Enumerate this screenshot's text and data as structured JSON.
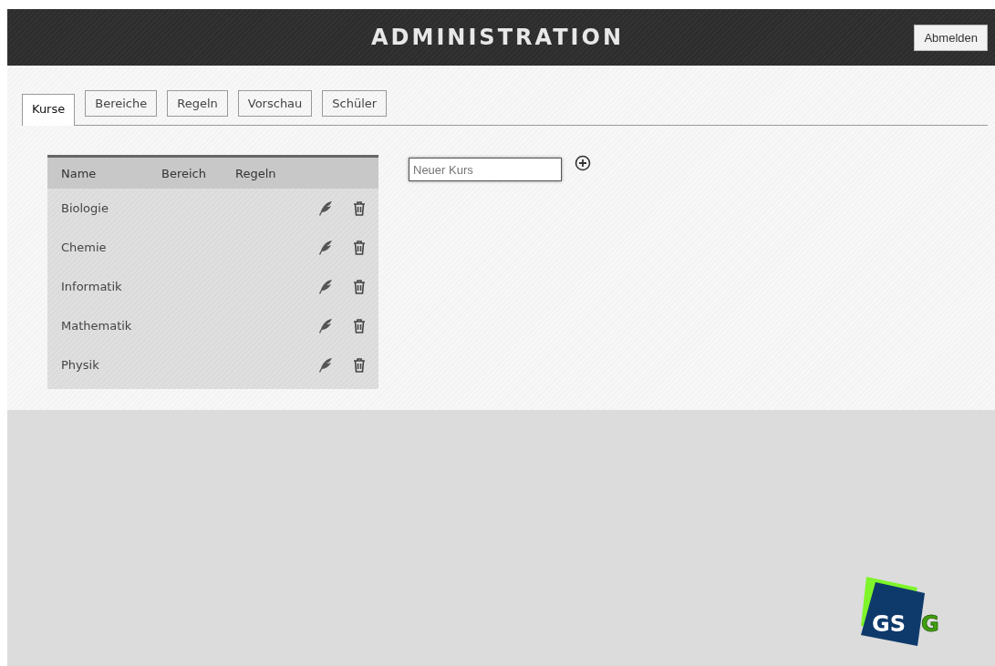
{
  "header": {
    "title": "ADMINISTRATION",
    "logout_button": "Abmelden"
  },
  "tabs": [
    {
      "label": "Kurse",
      "selected": true
    },
    {
      "label": "Bereiche",
      "selected": false
    },
    {
      "label": "Regeln",
      "selected": false
    },
    {
      "label": "Vorschau",
      "selected": false
    },
    {
      "label": "Schüler",
      "selected": false
    }
  ],
  "table": {
    "columns": [
      "Name",
      "Bereich",
      "Regeln"
    ],
    "rows": [
      {
        "name": "Biologie"
      },
      {
        "name": "Chemie"
      },
      {
        "name": "Informatik"
      },
      {
        "name": "Mathematik"
      },
      {
        "name": "Physik"
      }
    ]
  },
  "new_course": {
    "placeholder": "Neuer Kurs"
  },
  "logo": {
    "lead": "GS",
    "tail": "G"
  }
}
